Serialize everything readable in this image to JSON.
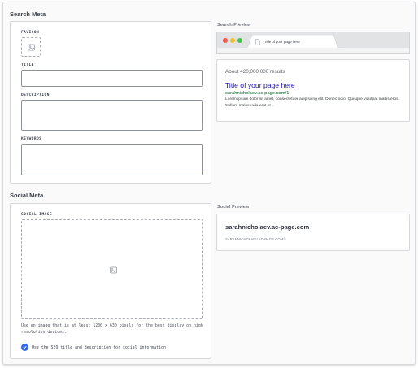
{
  "search_meta": {
    "section_title": "Search Meta",
    "favicon_label": "FAVICON",
    "title_label": "TITLE",
    "title_value": "",
    "description_label": "DESCRIPTION",
    "description_value": "",
    "keywords_label": "KEYWORDS",
    "keywords_value": ""
  },
  "search_preview": {
    "label": "Search Preview",
    "browser": {
      "tab_text": "Title of your page here",
      "dot_colors": [
        "#f05a55",
        "#f4bd2f",
        "#3ec64a"
      ]
    },
    "serp": {
      "results": "About 420,000,000 results",
      "title": "Title of your page here",
      "url": "sarahnicholaev.ac-page.com/1",
      "description": "Lorem ipsum dolor sit amet, consectetuer adipiscing elit. Donec odio. Quisque volutpat mattis eros. Nullam malesuada erat ut..."
    }
  },
  "social_meta": {
    "section_title": "Social Meta",
    "social_image_label": "SOCIAL IMAGE",
    "hint": "Use an image that is at least 1200 x 630 pixels for the best display on high resolution devices.",
    "checkbox_label": "Use the SEO title and description for social information",
    "checkbox_checked": true
  },
  "social_preview": {
    "label": "Social Preview",
    "domain": "sarahnicholaev.ac-page.com",
    "url": "SARAHNICHOLAEV.AC-PAGE.COM/1"
  },
  "colors": {
    "accent": "#356ae6",
    "link": "#1a0dab",
    "url": "#006621"
  },
  "icons": {
    "favicon_placeholder": "image-icon",
    "social_image_placeholder": "image-icon",
    "tab_page": "page-icon",
    "checkbox": "checkmark-icon"
  }
}
